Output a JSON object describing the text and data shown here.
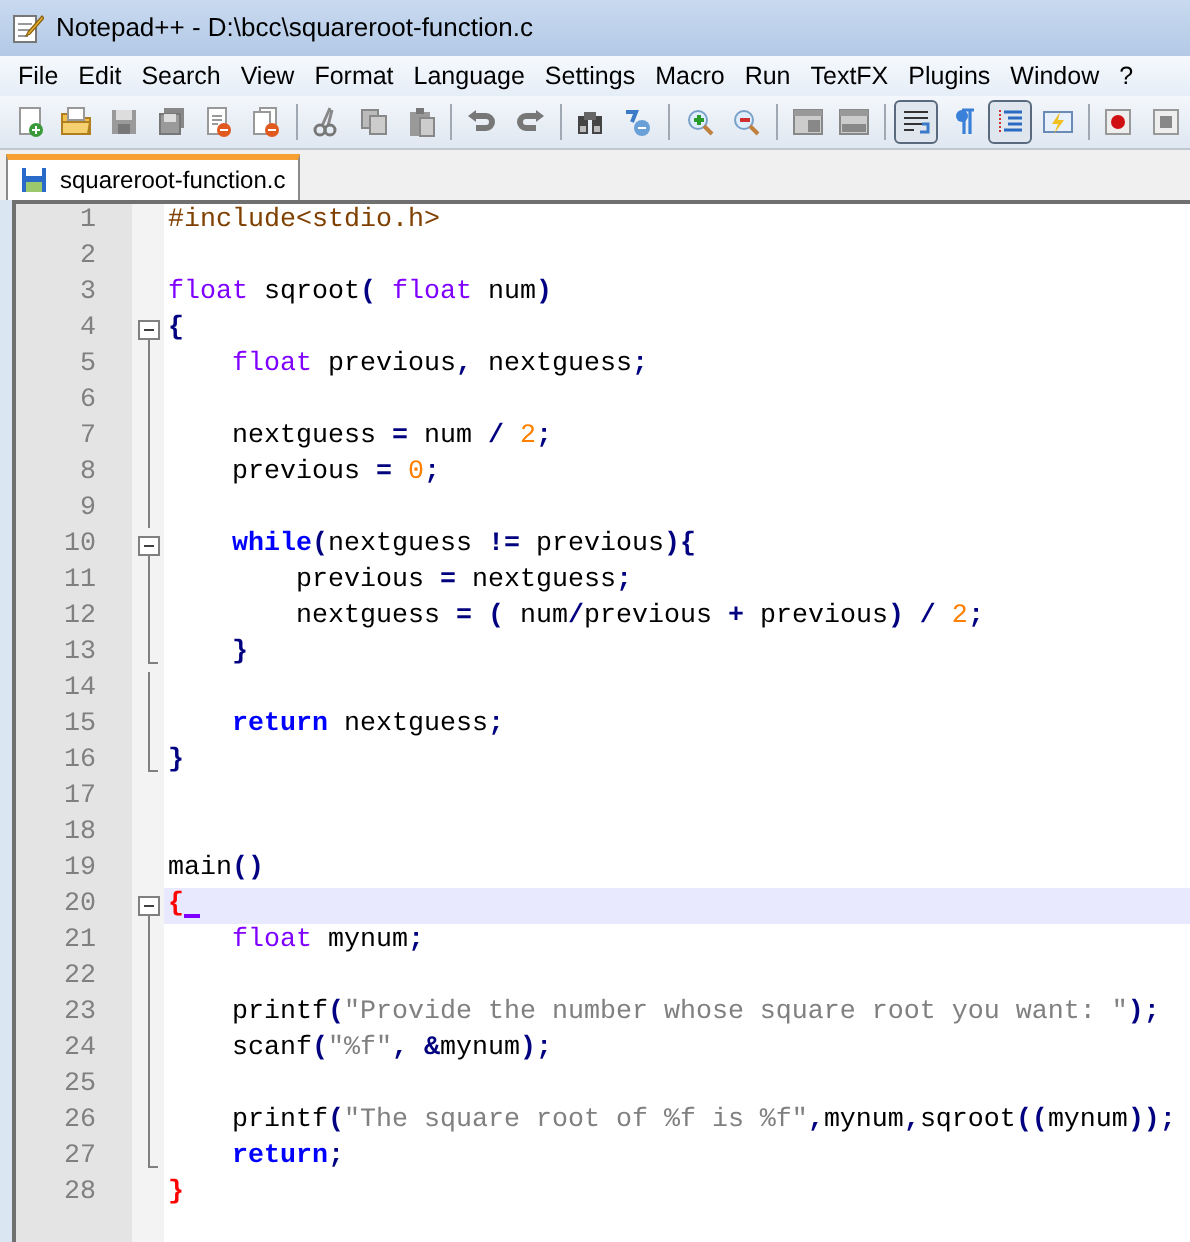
{
  "window": {
    "title": "Notepad++ - D:\\bcc\\squareroot-function.c"
  },
  "menu": [
    "File",
    "Edit",
    "Search",
    "View",
    "Format",
    "Language",
    "Settings",
    "Macro",
    "Run",
    "TextFX",
    "Plugins",
    "Window",
    "?"
  ],
  "toolbar": [
    [
      {
        "pressed": false
      },
      {
        "pressed": false
      },
      {
        "pressed": false
      },
      {
        "pressed": false
      },
      {
        "pressed": false
      },
      {
        "pressed": false
      }
    ],
    [
      {
        "pressed": false
      },
      {
        "pressed": false
      },
      {
        "pressed": false
      }
    ],
    [
      {
        "pressed": false
      },
      {
        "pressed": false
      }
    ],
    [
      {
        "pressed": false
      },
      {
        "pressed": false
      }
    ],
    [
      {
        "pressed": false
      },
      {
        "pressed": false
      }
    ],
    [
      {
        "pressed": false
      },
      {
        "pressed": false
      }
    ],
    [
      {
        "pressed": true
      },
      {
        "pressed": false
      },
      {
        "pressed": true
      },
      {
        "pressed": false
      }
    ],
    [
      {
        "pressed": false
      },
      {
        "pressed": false
      }
    ]
  ],
  "tabs": [
    {
      "label": "squareroot-function.c",
      "selected": true
    }
  ],
  "editor": {
    "lines": [
      {
        "number": "1",
        "kind": "plain",
        "tokens": [
          {
            "kind": "preproc",
            "text": "#include<stdio.h>"
          }
        ]
      },
      {
        "number": "2",
        "kind": "plain"
      },
      {
        "number": "3",
        "kind": "plain",
        "tokens": [
          {
            "kind": "type",
            "text": "float"
          },
          {
            "kind": "ident",
            "text": " sqroot"
          },
          {
            "kind": "op",
            "text": "("
          },
          {
            "kind": "type",
            "text": " float"
          },
          {
            "kind": "ident",
            "text": " num"
          },
          {
            "kind": "op",
            "text": ")"
          }
        ]
      },
      {
        "number": "4",
        "kind": "fold_start",
        "tokens": [
          {
            "kind": "op",
            "text": "{"
          }
        ]
      },
      {
        "number": "5",
        "kind": "fold_body",
        "tokens": [
          {
            "kind": "type",
            "text": "    float"
          },
          {
            "kind": "ident",
            "text": " previous"
          },
          {
            "kind": "op",
            "text": ","
          },
          {
            "kind": "ident",
            "text": " nextguess"
          },
          {
            "kind": "op",
            "text": ";"
          }
        ]
      },
      {
        "number": "6",
        "kind": "fold_body"
      },
      {
        "number": "7",
        "kind": "fold_body",
        "tokens": [
          {
            "kind": "ident",
            "text": "    nextguess "
          },
          {
            "kind": "op",
            "text": "="
          },
          {
            "kind": "ident",
            "text": " num "
          },
          {
            "kind": "op",
            "text": "/"
          },
          {
            "kind": "number",
            "text": " 2"
          },
          {
            "kind": "op",
            "text": ";"
          }
        ]
      },
      {
        "number": "8",
        "kind": "fold_body",
        "tokens": [
          {
            "kind": "ident",
            "text": "    previous "
          },
          {
            "kind": "op",
            "text": "="
          },
          {
            "kind": "number",
            "text": " 0"
          },
          {
            "kind": "op",
            "text": ";"
          }
        ]
      },
      {
        "number": "9",
        "kind": "fold_body"
      },
      {
        "number": "10",
        "kind": "fold_start",
        "tokens": [
          {
            "kind": "keyword",
            "text": "    while"
          },
          {
            "kind": "op",
            "text": "("
          },
          {
            "kind": "ident",
            "text": "nextguess "
          },
          {
            "kind": "op",
            "text": "!="
          },
          {
            "kind": "ident",
            "text": " previous"
          },
          {
            "kind": "op",
            "text": "){"
          }
        ]
      },
      {
        "number": "11",
        "kind": "fold_body",
        "tokens": [
          {
            "kind": "ident",
            "text": "        previous "
          },
          {
            "kind": "op",
            "text": "="
          },
          {
            "kind": "ident",
            "text": " nextguess"
          },
          {
            "kind": "op",
            "text": ";"
          }
        ]
      },
      {
        "number": "12",
        "kind": "fold_body",
        "tokens": [
          {
            "kind": "ident",
            "text": "        nextguess "
          },
          {
            "kind": "op",
            "text": "= ("
          },
          {
            "kind": "ident",
            "text": " num"
          },
          {
            "kind": "op",
            "text": "/"
          },
          {
            "kind": "ident",
            "text": "previous "
          },
          {
            "kind": "op",
            "text": "+"
          },
          {
            "kind": "ident",
            "text": " previous"
          },
          {
            "kind": "op",
            "text": ") /"
          },
          {
            "kind": "number",
            "text": " 2"
          },
          {
            "kind": "op",
            "text": ";"
          }
        ]
      },
      {
        "number": "13",
        "kind": "fold_end",
        "tokens": [
          {
            "kind": "op",
            "text": "    }"
          }
        ]
      },
      {
        "number": "14",
        "kind": "fold_body"
      },
      {
        "number": "15",
        "kind": "fold_body",
        "tokens": [
          {
            "kind": "keyword",
            "text": "    return"
          },
          {
            "kind": "ident",
            "text": " nextguess"
          },
          {
            "kind": "op",
            "text": ";"
          }
        ]
      },
      {
        "number": "16",
        "kind": "fold_end",
        "tokens": [
          {
            "kind": "op",
            "text": "}"
          }
        ]
      },
      {
        "number": "17",
        "kind": "plain"
      },
      {
        "number": "18",
        "kind": "plain"
      },
      {
        "number": "19",
        "kind": "plain",
        "tokens": [
          {
            "kind": "ident",
            "text": "main"
          },
          {
            "kind": "op",
            "text": "()"
          }
        ]
      },
      {
        "number": "20",
        "kind": "fold_start",
        "current": true,
        "caret": true,
        "tokens": [
          {
            "kind": "brace_match",
            "text": "{"
          }
        ]
      },
      {
        "number": "21",
        "kind": "fold_body",
        "tokens": [
          {
            "kind": "type",
            "text": "    float"
          },
          {
            "kind": "ident",
            "text": " mynum"
          },
          {
            "kind": "op",
            "text": ";"
          }
        ]
      },
      {
        "number": "22",
        "kind": "fold_body"
      },
      {
        "number": "23",
        "kind": "fold_body",
        "tokens": [
          {
            "kind": "ident",
            "text": "    printf"
          },
          {
            "kind": "op",
            "text": "("
          },
          {
            "kind": "string",
            "text": "\"Provide the number whose square root you want: \""
          },
          {
            "kind": "op",
            "text": ");"
          }
        ]
      },
      {
        "number": "24",
        "kind": "fold_body",
        "tokens": [
          {
            "kind": "ident",
            "text": "    scanf"
          },
          {
            "kind": "op",
            "text": "("
          },
          {
            "kind": "string",
            "text": "\"%f\""
          },
          {
            "kind": "op",
            "text": ", &"
          },
          {
            "kind": "ident",
            "text": "mynum"
          },
          {
            "kind": "op",
            "text": ");"
          }
        ]
      },
      {
        "number": "25",
        "kind": "fold_body"
      },
      {
        "number": "26",
        "kind": "fold_body",
        "tokens": [
          {
            "kind": "ident",
            "text": "    printf"
          },
          {
            "kind": "op",
            "text": "("
          },
          {
            "kind": "string",
            "text": "\"The square root of %f is %f\""
          },
          {
            "kind": "op",
            "text": ","
          },
          {
            "kind": "ident",
            "text": "mynum"
          },
          {
            "kind": "op",
            "text": ","
          },
          {
            "kind": "ident",
            "text": "sqroot"
          },
          {
            "kind": "op",
            "text": "(("
          },
          {
            "kind": "ident",
            "text": "mynum"
          },
          {
            "kind": "op",
            "text": "));"
          }
        ]
      },
      {
        "number": "27",
        "kind": "fold_end",
        "tokens": [
          {
            "kind": "keyword",
            "text": "    return"
          },
          {
            "kind": "op",
            "text": ";"
          }
        ]
      },
      {
        "number": "28",
        "kind": "plain",
        "tokens": [
          {
            "kind": "brace_match",
            "text": "}"
          }
        ]
      }
    ]
  }
}
